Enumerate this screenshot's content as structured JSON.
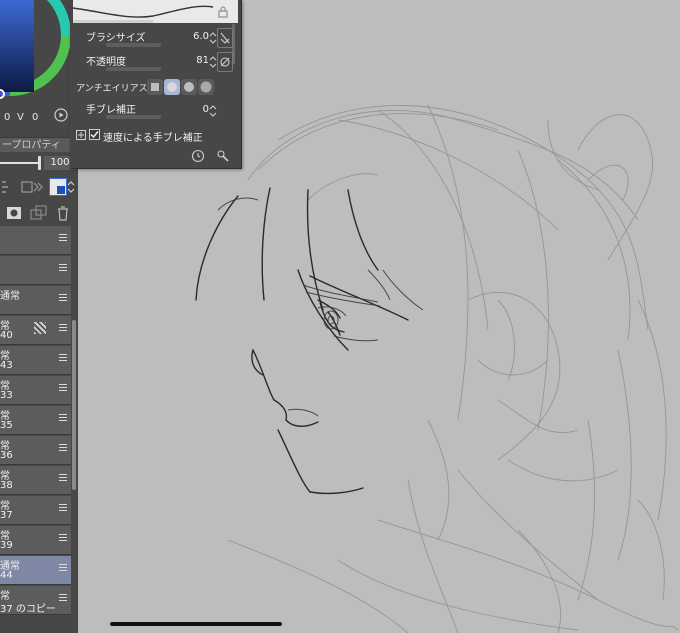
{
  "hsv": {
    "h": "0",
    "s": "V",
    "v": "0",
    "extra": "0"
  },
  "panel": {
    "property_tab": "ープロパティ",
    "opacity": "100"
  },
  "layers": [
    {
      "mode": "",
      "name": ""
    },
    {
      "mode": "",
      "name": ""
    },
    {
      "mode": "通常",
      "name": ""
    },
    {
      "mode": "常",
      "name": "40"
    },
    {
      "mode": "常",
      "name": "43"
    },
    {
      "mode": "常",
      "name": "33"
    },
    {
      "mode": "常",
      "name": "35"
    },
    {
      "mode": "常",
      "name": "36"
    },
    {
      "mode": "常",
      "name": "38"
    },
    {
      "mode": "常",
      "name": "37"
    },
    {
      "mode": "常",
      "name": "39"
    },
    {
      "mode": "通常",
      "name": "44"
    },
    {
      "mode": "常",
      "name": "37 のコピー"
    }
  ],
  "tool": {
    "brush_size_label": "ブラシサイズ",
    "brush_size_value": "6.0",
    "opacity_label": "不透明度",
    "opacity_value": "81",
    "aa_label": "アンチエイリアス",
    "stab_label": "手ブレ補正",
    "stab_value": "0",
    "speed_label": "速度による手ブレ補正"
  },
  "icons": {
    "lock": "lock-icon",
    "pressure": "pressure-icon",
    "no-pressure": "no-pressure-icon",
    "reset": "reset-icon",
    "wrench": "wrench-icon",
    "play": "play-icon",
    "trash": "trash-icon"
  }
}
